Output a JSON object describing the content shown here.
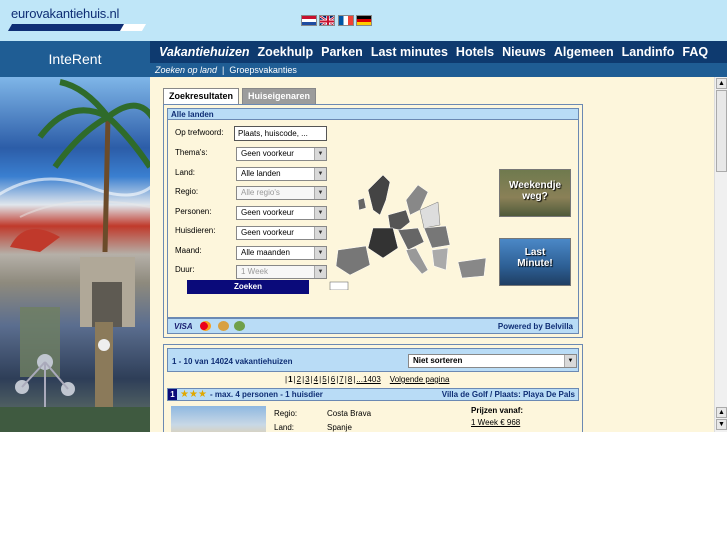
{
  "header": {
    "logo_text": "eurovakantiehuis.nl",
    "flags": [
      "nl-flag",
      "uk-flag",
      "fr-flag",
      "de-flag"
    ]
  },
  "brand": {
    "label": "InteRent"
  },
  "nav": {
    "items": [
      "Vakantiehuizen",
      "Zoekhulp",
      "Parken",
      "Last minutes",
      "Hotels",
      "Nieuws",
      "Algemeen",
      "Landinfo",
      "FAQ"
    ],
    "active": "Vakantiehuizen"
  },
  "subnav": {
    "items": [
      "Zoeken op land",
      "|",
      "Groepsvakanties"
    ]
  },
  "tabs": {
    "search_results": "Zoekresultaten",
    "owners": "Huiseigenaren"
  },
  "search": {
    "header": "Alle landen",
    "keyword_label": "Op trefwoord:",
    "keyword_value": "Plaats, huiscode, ...",
    "fields": [
      {
        "label": "Thema's:",
        "value": "Geen voorkeur",
        "disabled": false
      },
      {
        "label": "Land:",
        "value": "Alle landen",
        "disabled": false
      },
      {
        "label": "Regio:",
        "value": "Alle regio's",
        "disabled": true
      },
      {
        "label": "Personen:",
        "value": "Geen voorkeur",
        "disabled": false
      },
      {
        "label": "Huisdieren:",
        "value": "Geen voorkeur",
        "disabled": false
      },
      {
        "label": "Maand:",
        "value": "Alle maanden",
        "disabled": false
      },
      {
        "label": "Duur:",
        "value": "1 Week",
        "disabled": true
      }
    ],
    "submit_label": "Zoeken",
    "promos": [
      {
        "line1": "Weekendje",
        "line2": "weg?"
      },
      {
        "line1": "Last",
        "line2": "Minute!"
      }
    ],
    "footer_left": "VISA",
    "footer_right": "Powered by Belvilla"
  },
  "results": {
    "count": "1 - 10 van 14024 vakantiehuizen",
    "sort_value": "Niet sorteren",
    "pages": [
      "1",
      "2",
      "3",
      "4",
      "5",
      "6",
      "7",
      "8",
      "...1403"
    ],
    "current_page": "1",
    "next_label": "Volgende pagina",
    "first_row": {
      "number": "1",
      "stars": 3,
      "info": "- max. 4 personen - 1 huisdier",
      "title": "Villa de Golf / Plaats: Playa De Pals",
      "region_label": "Regio:",
      "region_value": "Costa Brava",
      "country_label": "Land:",
      "country_value": "Spanje",
      "price_label": "Prijzen vanaf:",
      "price_value": "1 Week € 968"
    }
  },
  "colors": {
    "nav_bg": "#0e3a6f",
    "header_bg": "#bfe6f8",
    "panel_head": "#b9dcf6",
    "page_bg": "#fdf6dc"
  }
}
